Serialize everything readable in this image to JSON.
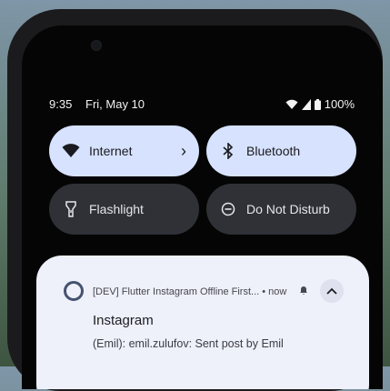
{
  "status_bar": {
    "time": "9:35",
    "date": "Fri, May 10",
    "battery": "100%",
    "icons": [
      "wifi-icon",
      "signal-icon",
      "battery-icon"
    ]
  },
  "quick_settings": {
    "tiles": [
      {
        "label": "Internet",
        "state": "on",
        "icon": "wifi-icon",
        "has_chevron": true
      },
      {
        "label": "Bluetooth",
        "state": "on",
        "icon": "bluetooth-icon"
      },
      {
        "label": "Flashlight",
        "state": "off",
        "icon": "flashlight-icon"
      },
      {
        "label": "Do Not Disturb",
        "state": "off",
        "icon": "do-not-disturb-icon"
      }
    ]
  },
  "notification": {
    "app_name": "[DEV] Flutter Instagram Offline First...",
    "time": "• now",
    "title": "Instagram",
    "body": "(Emil): emil.zulufov: Sent post by Emil",
    "icons": [
      "app-icon",
      "bell-icon",
      "expand-icon"
    ]
  },
  "colors": {
    "tile_on": "#d7e2ff",
    "tile_off": "#2f3136",
    "card_bg": "#eef0fa",
    "screen_bg": "#050505"
  }
}
